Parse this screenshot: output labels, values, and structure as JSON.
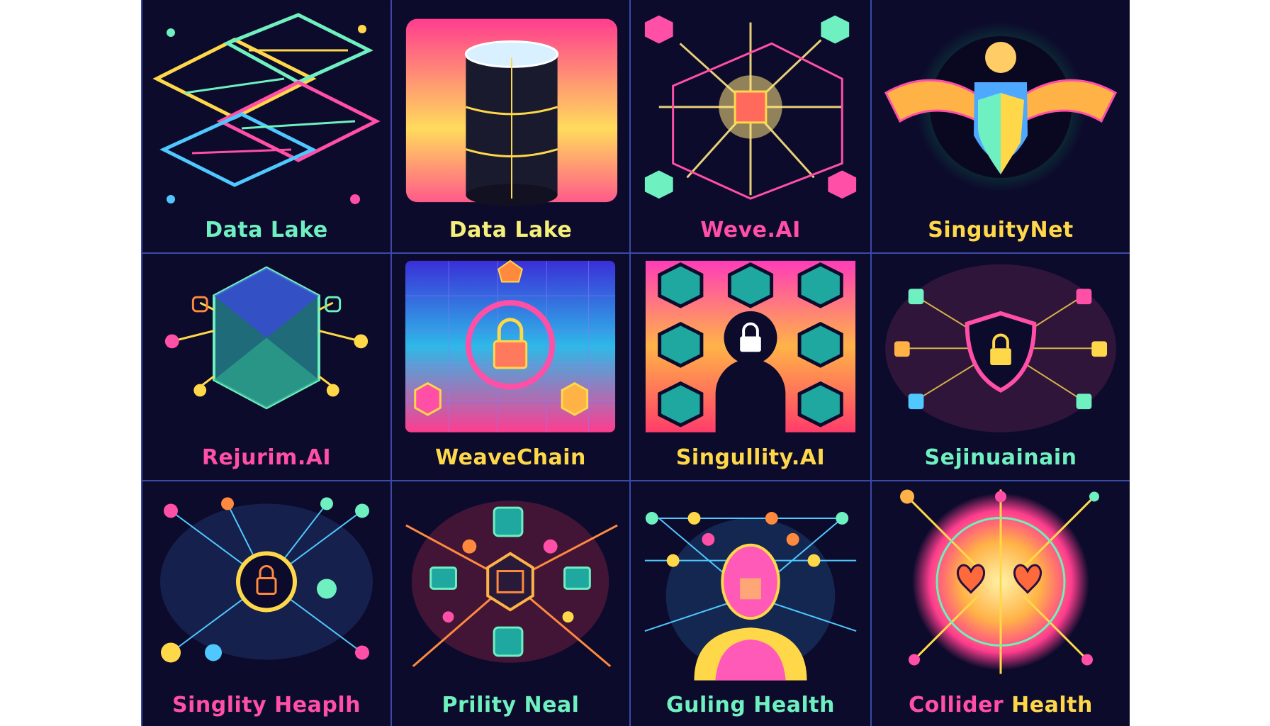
{
  "tiles": [
    {
      "label": "Data Lake",
      "color": "#6ff0c0",
      "icon": "isometric-grid-icon"
    },
    {
      "label": "Data Lake",
      "color": "#f4f07a",
      "icon": "database-cylinder-icon"
    },
    {
      "label": "Weve.AI",
      "color": "#ff4fa6",
      "icon": "starburst-network-icon"
    },
    {
      "label": "SinguityNet",
      "color": "#ffd84a",
      "icon": "winged-shield-figure-icon"
    },
    {
      "label": "Rejurim.AI",
      "color": "#ff4fa6",
      "accent": "#ffd84a",
      "icon": "hexagon-network-icon"
    },
    {
      "label": "WeaveChain",
      "color": "#ffd84a",
      "icon": "padlock-grid-icon"
    },
    {
      "label": "Singullity.AI",
      "color": "#ffd84a",
      "icon": "padlock-silhouette-icon"
    },
    {
      "label": "Sejinuainain",
      "color": "#6ff0c0",
      "icon": "shield-padlock-icon"
    },
    {
      "label": "Singlity Heaplh",
      "color": "#ff4fa6",
      "icon": "padlock-network-icon"
    },
    {
      "label": "Prility Neal",
      "color": "#6ff0c0",
      "icon": "hexagon-chip-network-icon"
    },
    {
      "label": "Guling Health",
      "color": "#6ff0c0",
      "icon": "head-network-icon"
    },
    {
      "label": "Collider Health",
      "color": "#ff4fa6",
      "accent": "#ffd84a",
      "icon": "glowing-hearts-icon"
    }
  ]
}
